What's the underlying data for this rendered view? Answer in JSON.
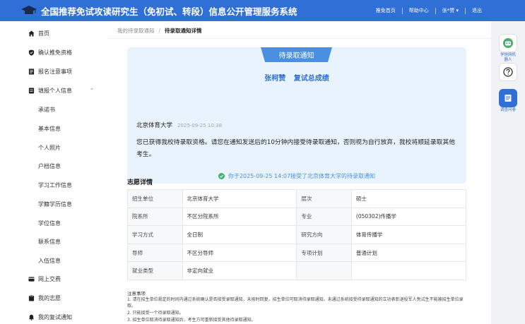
{
  "header": {
    "title": "全国推荐免试攻读研究生（免初试、转段）信息公开管理服务系统",
    "nav": [
      "推免首页",
      "帮助中心",
      "张*赞 ▾",
      "退出"
    ]
  },
  "sidebar": {
    "home": "首页",
    "confirm": "确认推免资格",
    "notice": "报名注意事项",
    "fill": "填报个人信息",
    "sub": [
      "承诺书",
      "基本信息",
      "个人照片",
      "户档信息",
      "学习工作信息",
      "学籍学历信息",
      "学位信息",
      "联系信息",
      "入伍信息"
    ],
    "pay": "网上交费",
    "wishes": "我的志愿",
    "retest": "我的复试通知"
  },
  "breadcrumb": {
    "parent": "我的待录取通知",
    "sep": "/",
    "current": "待录取通知详情"
  },
  "notice": {
    "ribbon": "待录取通知",
    "student": "张柯赞",
    "retest": "复试总成绩",
    "university": "北京体育大学",
    "sent_time": "2025-09-25 10:38",
    "message": "您已获得我校待录取资格。请您在通知发送后的10分钟内接受待录取通知，否则视为自行放弃，我校将顺延录取其他考生。",
    "accepted": "你于2025-09-25 14:07接受了北京体育大学的待录取通知"
  },
  "details": {
    "title": "志愿详情",
    "rows": [
      {
        "k1": "招生单位",
        "v1": "北京体育大学",
        "k2": "层次",
        "v2": "硕士"
      },
      {
        "k1": "院系所",
        "v1": "不区分院系所",
        "k2": "专业",
        "v2": "(050302)传播学"
      },
      {
        "k1": "学习方式",
        "v1": "全日制",
        "k2": "研究方向",
        "v2": "体育传播学"
      },
      {
        "k1": "导师",
        "v1": "不区分导师",
        "k2": "专项计划",
        "v2": "普通计划"
      },
      {
        "k1": "就业类型",
        "v1": "非定向就业",
        "k2": "",
        "v2": ""
      }
    ]
  },
  "notes": {
    "title": "注意事项",
    "items": [
      "1. 请在招生单位规定的时间内通过系统确认是否接受录取通知，未按时回复，招生单位可取消待录取通知。未通过系统接受待录取通知的立功表彰退役军人免试生不能被招生单位录取。",
      "2. 只能接受一个待录取通知。",
      "3. 招生单位取消待录取通知后，考生方可重新接受其他待录取通知。"
    ]
  },
  "float": {
    "assistant": "学信网机器人",
    "survey": "调查问卷"
  },
  "colors": {
    "primary": "#2f6fd6",
    "ribbon": "#4a90e2",
    "notice_bg": "#e9f3fd",
    "success": "#3bb56b"
  }
}
